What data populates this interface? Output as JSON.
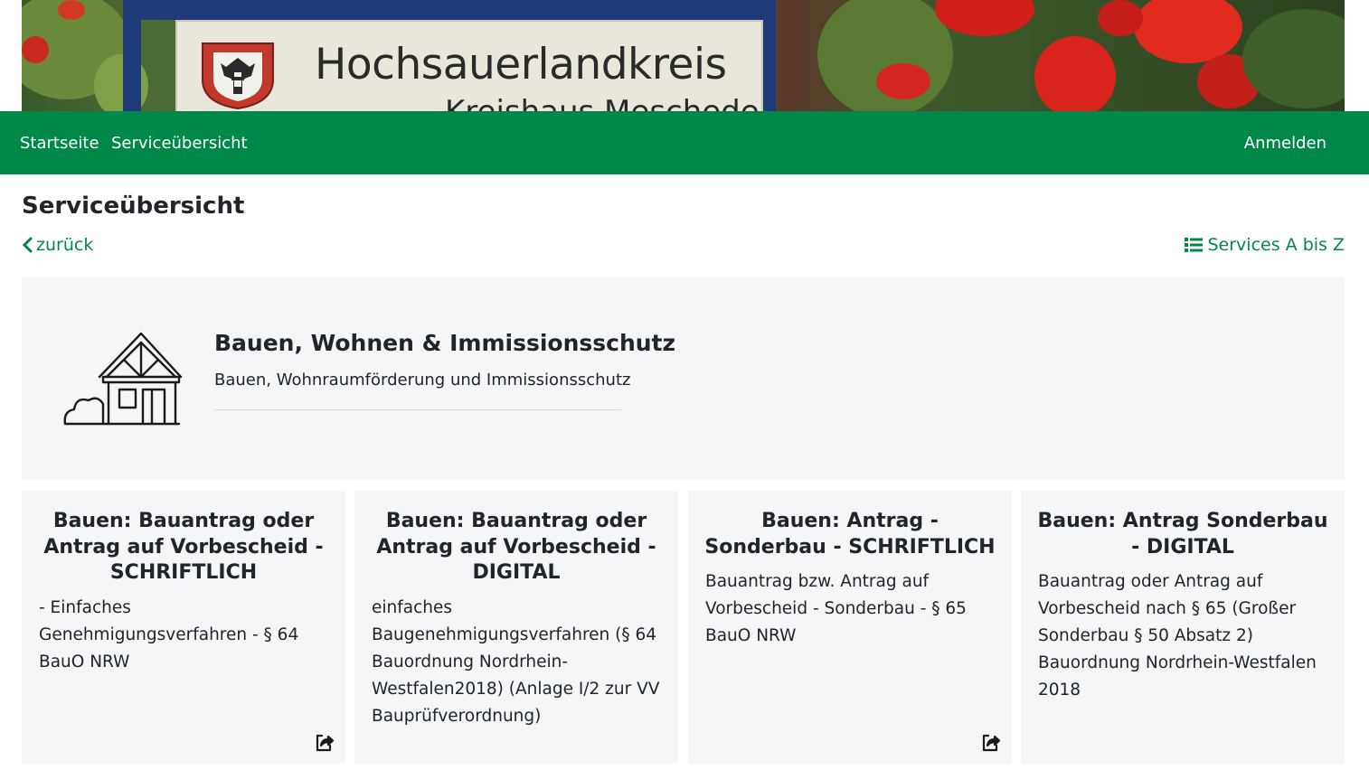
{
  "banner": {
    "sign_title": "Hochsauerlandkreis",
    "sign_subtitle": "Kreishaus Meschede"
  },
  "nav": {
    "home": "Startseite",
    "services": "Serviceübersicht",
    "login": "Anmelden"
  },
  "header": {
    "title": "Serviceübersicht",
    "back": "zurück",
    "az": "Services A bis Z"
  },
  "category": {
    "icon": "house-construction-icon",
    "title": "Bauen, Wohnen & Immissionsschutz",
    "description": "Bauen, Wohnraumförderung und Immissionsschutz"
  },
  "cards": [
    {
      "title": "Bauen: Bauantrag oder Antrag auf Vorbescheid - SCHRIFTLICH",
      "description": "- Einfaches Genehmigungsverfahren - § 64 BauO NRW",
      "has_open_icon": true
    },
    {
      "title": "Bauen: Bauantrag oder Antrag auf Vorbescheid - DIGITAL",
      "description": "einfaches Baugenehmigungsverfahren (§ 64 Bauordnung Nordrhein-Westfalen2018) (Anlage I/2 zur VV Bauprüfverordnung)",
      "has_open_icon": false
    },
    {
      "title": "Bauen: Antrag - Sonderbau - SCHRIFTLICH",
      "description": "Bauantrag bzw. Antrag auf Vorbescheid - Sonderbau - § 65 BauO NRW",
      "has_open_icon": true
    },
    {
      "title": "Bauen: Antrag Sonderbau - DIGITAL",
      "description": "Bauantrag oder Antrag auf Vorbescheid nach § 65 (Großer Sonderbau § 50 Absatz 2) Bauordnung Nordrhein-Westfalen 2018",
      "has_open_icon": false
    }
  ],
  "colors": {
    "brand_green": "#00884a",
    "panel_bg": "#f4f6f7",
    "text": "#212529"
  }
}
